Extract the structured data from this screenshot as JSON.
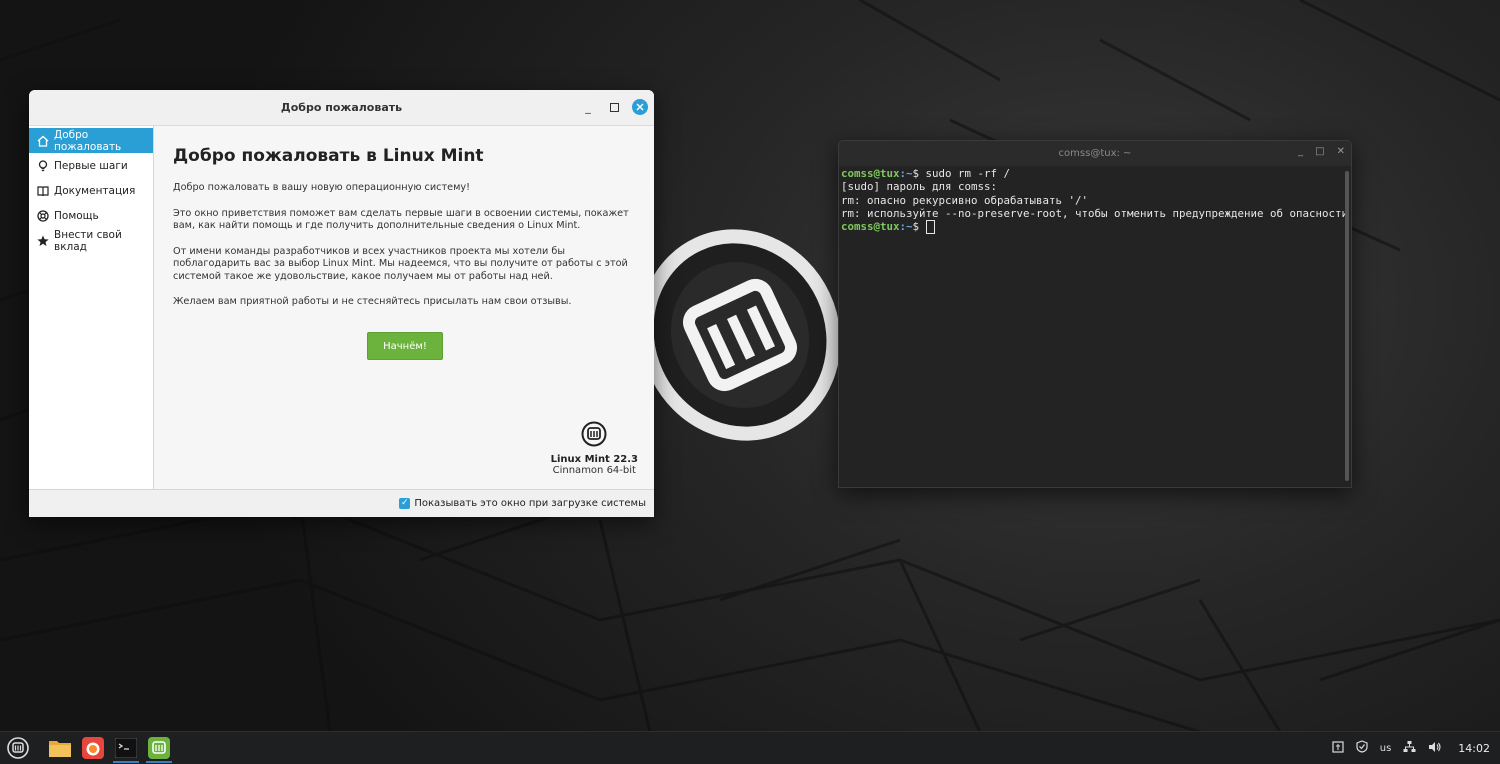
{
  "welcome": {
    "window_title": "Добро пожаловать",
    "sidebar": [
      {
        "label": "Добро пожаловать",
        "icon": "home-icon",
        "active": true
      },
      {
        "label": "Первые шаги",
        "icon": "lightbulb-icon",
        "active": false
      },
      {
        "label": "Документация",
        "icon": "book-icon",
        "active": false
      },
      {
        "label": "Помощь",
        "icon": "lifebuoy-icon",
        "active": false
      },
      {
        "label": "Внести свой вклад",
        "icon": "star-icon",
        "active": false
      }
    ],
    "heading": "Добро пожаловать в Linux Mint",
    "paragraphs": [
      "Добро пожаловать в вашу новую операционную систему!",
      "Это окно приветствия поможет вам сделать первые шаги в освоении системы, покажет вам, как найти помощь и где получить дополнительные сведения о Linux Mint.",
      "От имени команды разработчиков и всех участников проекта мы хотели бы поблагодарить вас за выбор Linux Mint. Мы надеемся, что вы получите от работы с этой системой такое же удовольствие, какое получаем мы от работы над ней.",
      "Желаем вам приятной работы и не стесняйтесь присылать нам свои отзывы."
    ],
    "start_button": "Начнём!",
    "brand_name": "Linux Mint 22.3",
    "brand_edition": "Cinnamon 64-bit",
    "show_on_startup_label": "Показывать это окно при загрузке системы",
    "show_on_startup_checked": true
  },
  "terminal": {
    "window_title": "comss@tux: ~",
    "lines": [
      {
        "user": "comss@tux",
        "path": ":~",
        "cmd": "$ sudo rm -rf /"
      },
      {
        "text": "[sudo] пароль для comss:"
      },
      {
        "text": "rm: опасно рекурсивно обрабатывать '/'"
      },
      {
        "text": "rm: используйте --no-preserve-root, чтобы отменить предупреждение об опасности"
      },
      {
        "user": "comss@tux",
        "path": ":~",
        "cmd": "$ "
      }
    ]
  },
  "taskbar": {
    "keyboard_layout": "us",
    "clock": "14:02"
  },
  "colors": {
    "accent": "#2a9fd6",
    "start_button": "#6cb33e",
    "prompt_user": "#7ec85c",
    "prompt_path": "#6aa3e0"
  }
}
